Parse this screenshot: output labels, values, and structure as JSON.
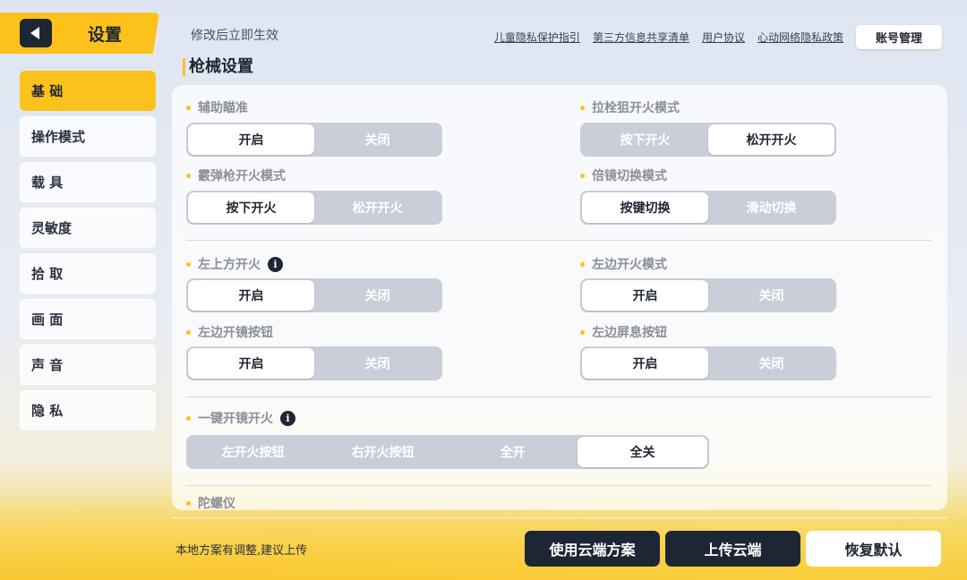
{
  "header": {
    "title": "设置",
    "hint": "修改后立即生效",
    "links": [
      "儿童隐私保护指引",
      "第三方信息共享清单",
      "用户协议",
      "心动网络隐私政策"
    ],
    "account_button": "账号管理"
  },
  "sidebar": {
    "items": [
      {
        "label": "基 础",
        "active": true
      },
      {
        "label": "操作模式",
        "active": false
      },
      {
        "label": "载 具",
        "active": false
      },
      {
        "label": "灵敏度",
        "active": false
      },
      {
        "label": "拾 取",
        "active": false
      },
      {
        "label": "画 面",
        "active": false
      },
      {
        "label": "声 音",
        "active": false
      },
      {
        "label": "隐 私",
        "active": false
      }
    ]
  },
  "section": {
    "title": "枪械设置",
    "settings": {
      "aim_assist": {
        "label": "辅助瞄准",
        "options": [
          "开启",
          "关闭"
        ],
        "selected": "开启"
      },
      "bolt_fire": {
        "label": "拉栓狙开火模式",
        "options": [
          "按下开火",
          "松开开火"
        ],
        "selected": "松开开火"
      },
      "shotgun_fire": {
        "label": "霰弹枪开火模式",
        "options": [
          "按下开火",
          "松开开火"
        ],
        "selected": "按下开火"
      },
      "scope_switch": {
        "label": "倍镜切换模式",
        "options": [
          "按键切换",
          "滑动切换"
        ],
        "selected": "按键切换"
      },
      "top_left_fire": {
        "label": "左上方开火",
        "options": [
          "开启",
          "关闭"
        ],
        "selected": "开启"
      },
      "left_fire_mode": {
        "label": "左边开火模式",
        "options": [
          "开启",
          "关闭"
        ],
        "selected": "开启"
      },
      "left_scope_button": {
        "label": "左边开镜按钮",
        "options": [
          "开启",
          "关闭"
        ],
        "selected": "开启"
      },
      "left_hold_breath": {
        "label": "左边屏息按钮",
        "options": [
          "开启",
          "关闭"
        ],
        "selected": "开启"
      },
      "one_key_scope_fire": {
        "label": "一键开镜开火",
        "options": [
          "左开火按钮",
          "右开火按钮",
          "全开",
          "全关"
        ],
        "selected": "全关"
      },
      "gyro": {
        "label": "陀螺仪"
      }
    }
  },
  "footer": {
    "note": "本地方案有调整,建议上传",
    "use_cloud": "使用云端方案",
    "upload_cloud": "上传云端",
    "restore_default": "恢复默认"
  },
  "colors": {
    "accent": "#fcc21b",
    "dark": "#1f2633"
  }
}
